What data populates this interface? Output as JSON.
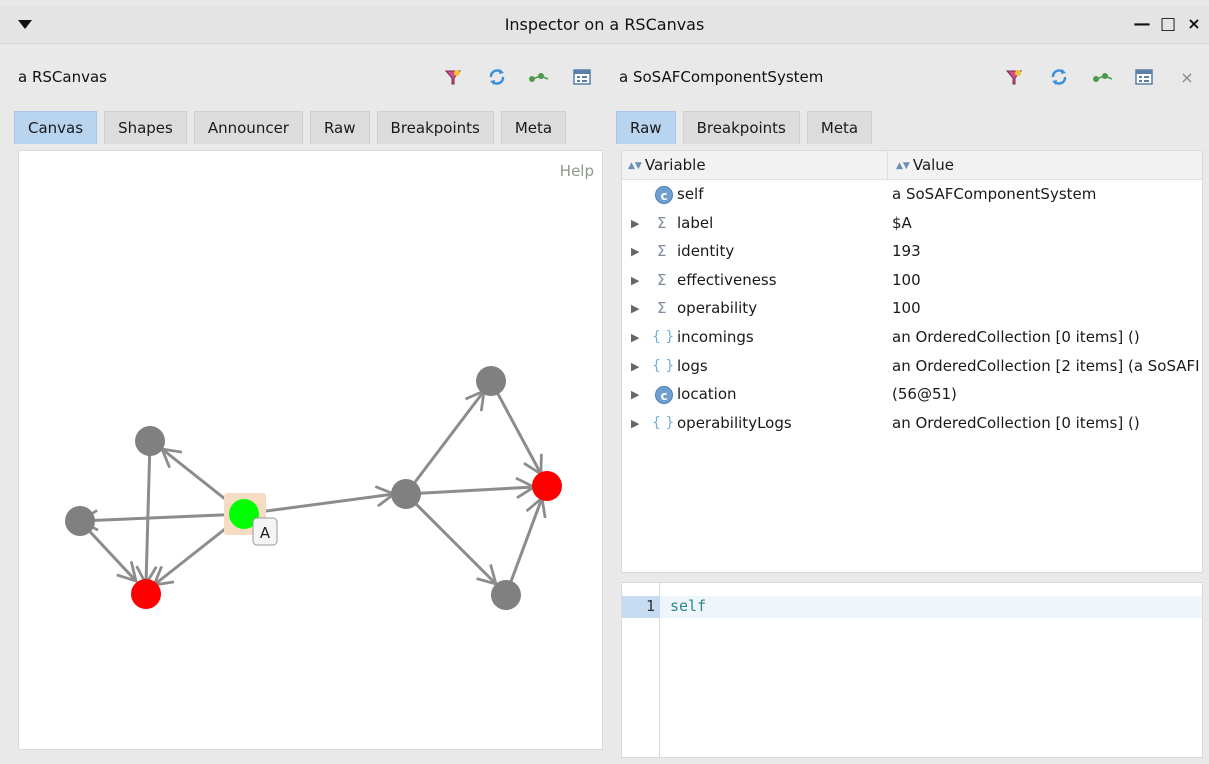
{
  "window": {
    "title": "Inspector on a RSCanvas"
  },
  "left_pane": {
    "title": "a RSCanvas",
    "tools": [
      "filter-icon",
      "refresh-icon",
      "browse-icon",
      "inspect-icon"
    ],
    "tabs": [
      {
        "label": "Canvas",
        "active": true
      },
      {
        "label": "Shapes",
        "active": false
      },
      {
        "label": "Announcer",
        "active": false
      },
      {
        "label": "Raw",
        "active": false
      },
      {
        "label": "Breakpoints",
        "active": false
      },
      {
        "label": "Meta",
        "active": false
      }
    ],
    "canvas": {
      "help_label": "Help",
      "node_label": "A",
      "colors": {
        "gray": "#808080",
        "red": "#ff0000",
        "green": "#00ff00",
        "highlight": "#f6dcc2",
        "edge": "#8c8c8c"
      }
    }
  },
  "right_pane": {
    "title": "a SoSAFComponentSystem",
    "tools": [
      "filter-icon",
      "refresh-icon",
      "browse-icon",
      "inspect-icon",
      "close-icon"
    ],
    "tabs": [
      {
        "label": "Raw",
        "active": true
      },
      {
        "label": "Breakpoints",
        "active": false
      },
      {
        "label": "Meta",
        "active": false
      }
    ],
    "table": {
      "columns": [
        "Variable",
        "Value"
      ],
      "rows": [
        {
          "kind": "class",
          "glyph": "c",
          "expandable": false,
          "name": "self",
          "value": "a SoSAFComponentSystem"
        },
        {
          "kind": "sigma",
          "glyph": "Σ",
          "expandable": true,
          "name": "label",
          "value": "$A"
        },
        {
          "kind": "sigma",
          "glyph": "Σ",
          "expandable": true,
          "name": "identity",
          "value": "193"
        },
        {
          "kind": "sigma",
          "glyph": "Σ",
          "expandable": true,
          "name": "effectiveness",
          "value": "100"
        },
        {
          "kind": "sigma",
          "glyph": "Σ",
          "expandable": true,
          "name": "operability",
          "value": "100"
        },
        {
          "kind": "brace",
          "glyph": "{ }",
          "expandable": true,
          "name": "incomings",
          "value": "an OrderedCollection [0 items] ()"
        },
        {
          "kind": "brace",
          "glyph": "{ }",
          "expandable": true,
          "name": "logs",
          "value": "an OrderedCollection [2 items] (a SoSAFI"
        },
        {
          "kind": "class",
          "glyph": "c",
          "expandable": true,
          "name": "location",
          "value": "(56@51)"
        },
        {
          "kind": "brace",
          "glyph": "{ }",
          "expandable": true,
          "name": "operabilityLogs",
          "value": "an OrderedCollection [0 items] ()"
        }
      ]
    },
    "code": {
      "line_number": "1",
      "text": "self"
    }
  }
}
